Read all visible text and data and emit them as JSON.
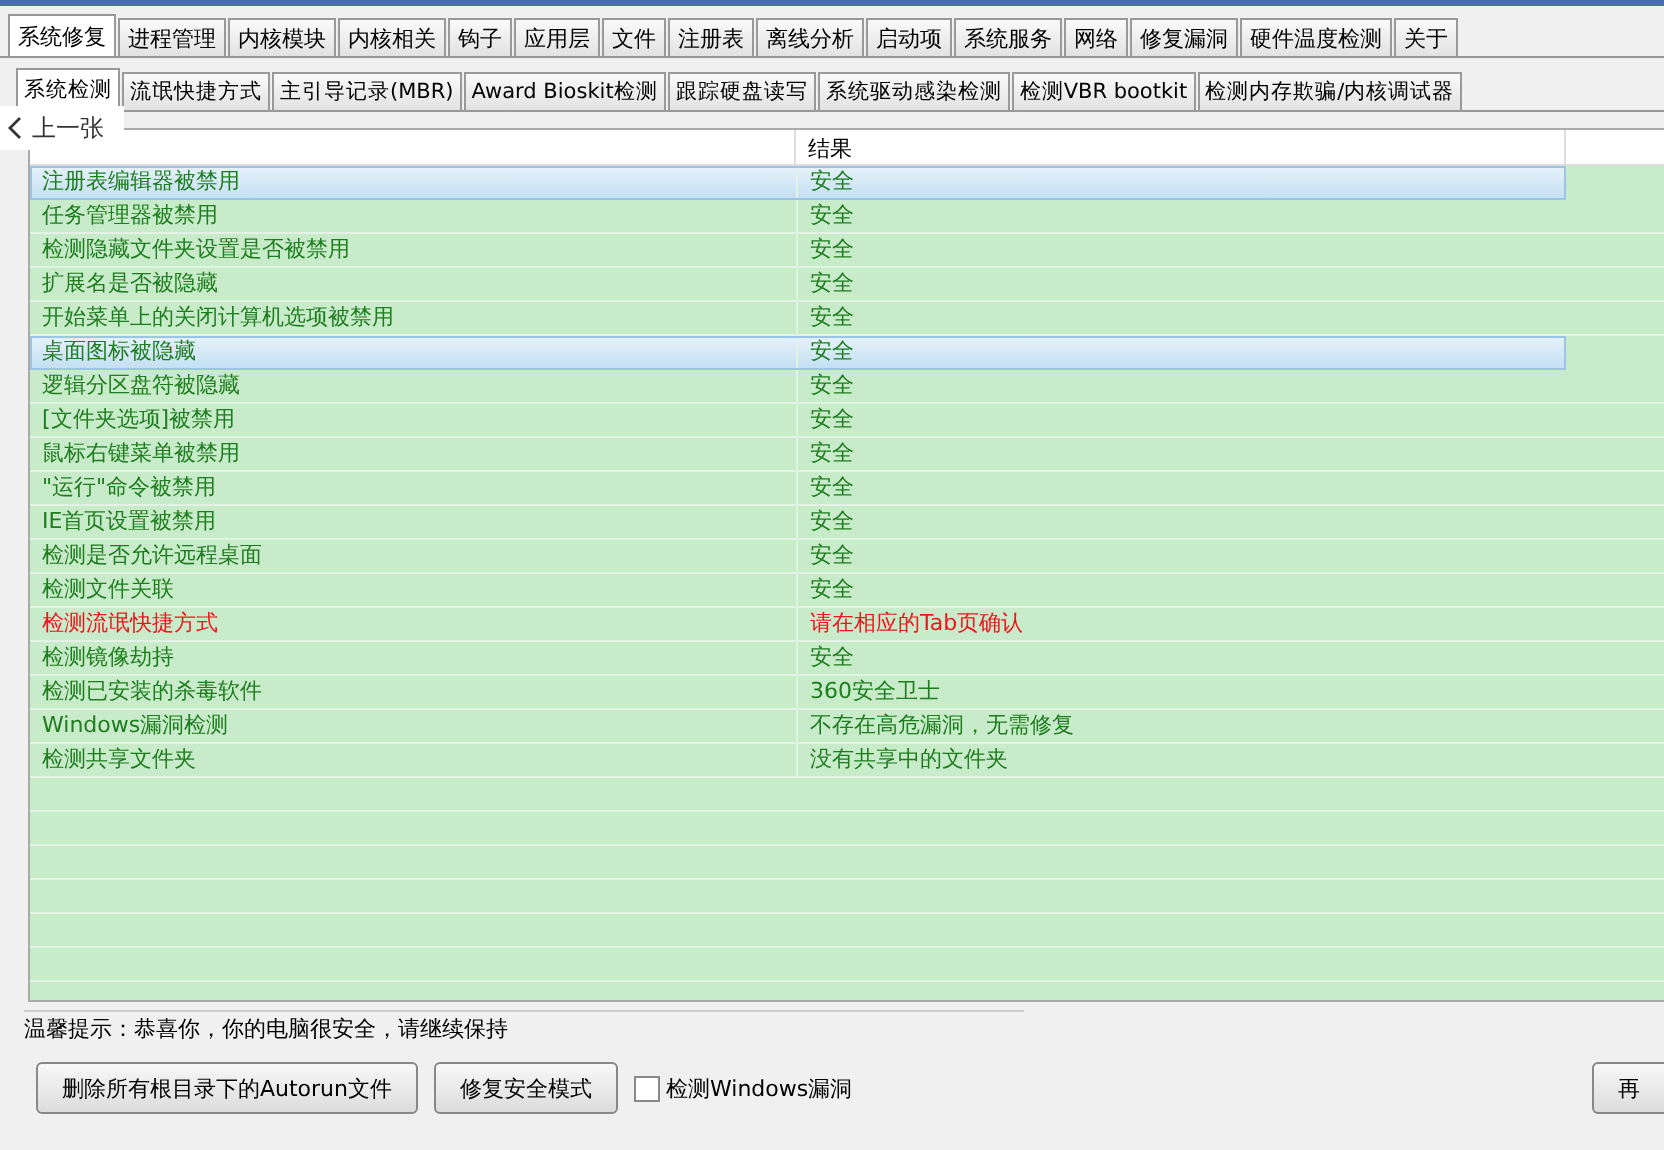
{
  "main_tabs": [
    {
      "label": "系统修复",
      "selected": true
    },
    {
      "label": "进程管理",
      "selected": false
    },
    {
      "label": "内核模块",
      "selected": false
    },
    {
      "label": "内核相关",
      "selected": false
    },
    {
      "label": "钩子",
      "selected": false
    },
    {
      "label": "应用层",
      "selected": false
    },
    {
      "label": "文件",
      "selected": false
    },
    {
      "label": "注册表",
      "selected": false
    },
    {
      "label": "离线分析",
      "selected": false
    },
    {
      "label": "启动项",
      "selected": false
    },
    {
      "label": "系统服务",
      "selected": false
    },
    {
      "label": "网络",
      "selected": false
    },
    {
      "label": "修复漏洞",
      "selected": false
    },
    {
      "label": "硬件温度检测",
      "selected": false
    },
    {
      "label": "关于",
      "selected": false
    }
  ],
  "sub_tabs": [
    {
      "label": "系统检测",
      "selected": true
    },
    {
      "label": "流氓快捷方式",
      "selected": false
    },
    {
      "label": "主引导记录(MBR)",
      "selected": false
    },
    {
      "label": "Award Bioskit检测",
      "selected": false
    },
    {
      "label": "跟踪硬盘读写",
      "selected": false
    },
    {
      "label": "系统驱动感染检测",
      "selected": false
    },
    {
      "label": "检测VBR bootkit",
      "selected": false
    },
    {
      "label": "检测内存欺骗/内核调试器",
      "selected": false
    }
  ],
  "prev_button": "上一张",
  "table": {
    "result_header": "结果",
    "rows": [
      {
        "item": "注册表编辑器被禁用",
        "result": "安全",
        "kind": "ok",
        "selected": true
      },
      {
        "item": "任务管理器被禁用",
        "result": "安全",
        "kind": "ok",
        "selected": false
      },
      {
        "item": "检测隐藏文件夹设置是否被禁用",
        "result": "安全",
        "kind": "ok",
        "selected": false
      },
      {
        "item": "扩展名是否被隐藏",
        "result": "安全",
        "kind": "ok",
        "selected": false
      },
      {
        "item": "开始菜单上的关闭计算机选项被禁用",
        "result": "安全",
        "kind": "ok",
        "selected": false
      },
      {
        "item": "桌面图标被隐藏",
        "result": "安全",
        "kind": "ok",
        "selected": true
      },
      {
        "item": "逻辑分区盘符被隐藏",
        "result": "安全",
        "kind": "ok",
        "selected": false
      },
      {
        "item": "[文件夹选项]被禁用",
        "result": "安全",
        "kind": "ok",
        "selected": false
      },
      {
        "item": "鼠标右键菜单被禁用",
        "result": "安全",
        "kind": "ok",
        "selected": false
      },
      {
        "item": "\"运行\"命令被禁用",
        "result": "安全",
        "kind": "ok",
        "selected": false
      },
      {
        "item": "IE首页设置被禁用",
        "result": "安全",
        "kind": "ok",
        "selected": false
      },
      {
        "item": "检测是否允许远程桌面",
        "result": "安全",
        "kind": "ok",
        "selected": false
      },
      {
        "item": "检测文件关联",
        "result": "安全",
        "kind": "ok",
        "selected": false
      },
      {
        "item": "检测流氓快捷方式",
        "result": "请在相应的Tab页确认",
        "kind": "warning",
        "selected": false
      },
      {
        "item": "检测镜像劫持",
        "result": "安全",
        "kind": "ok",
        "selected": false
      },
      {
        "item": "检测已安装的杀毒软件",
        "result": "360安全卫士",
        "kind": "ok",
        "selected": false
      },
      {
        "item": "Windows漏洞检测",
        "result": "不存在高危漏洞，无需修复",
        "kind": "ok",
        "selected": false
      },
      {
        "item": "检测共享文件夹",
        "result": "没有共享中的文件夹",
        "kind": "ok",
        "selected": false
      }
    ]
  },
  "tip": "温馨提示：恭喜你，你的电脑很安全，请继续保持",
  "buttons": [
    "删除所有根目录下的Autorun文件",
    "修复安全模式"
  ],
  "check_windows": {
    "label": "检测Windows漏洞",
    "checked": false
  },
  "right_button": "再"
}
